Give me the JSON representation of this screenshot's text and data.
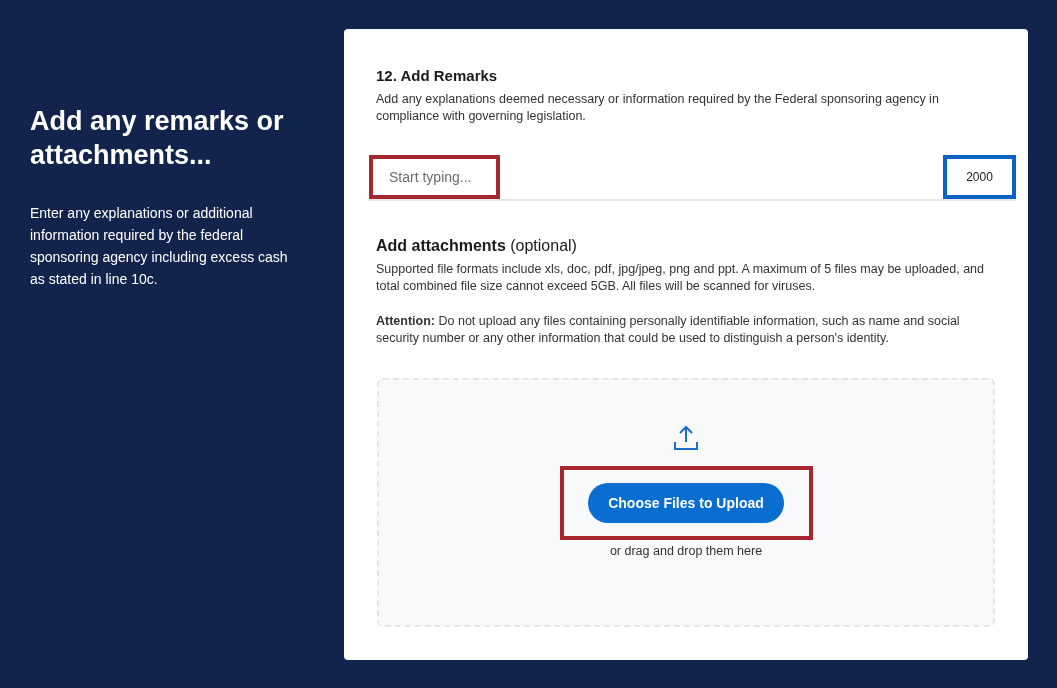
{
  "sidebar": {
    "title": "Add any remarks or attachments...",
    "description": "Enter any explanations or additional information required by the federal sponsoring agency including excess cash as stated in line 10c."
  },
  "remarks": {
    "title": "12. Add Remarks",
    "description": "Add any explanations deemed necessary or information required by the Federal sponsoring agency in compliance with governing legislation.",
    "input": {
      "placeholder": "Start typing...",
      "color": "#a8262e"
    },
    "character_count": {
      "text": "2000",
      "color": "#0b63c6"
    }
  },
  "attachments": {
    "title": "**Add attachments** (optional)",
    "description": "Supported file formats include xls, doc, pdf, jpg/jpeg, png and ppt. A maximum of 5 files may be uploaded, and total combined file size cannot exceed 5GB. All files will be scanned for viruses.",
    "attention": "**Attention:** Do not upload any files containing personally identifiable information, such as name and social security number or any other information that could be used to distinguish a person's identity.",
    "dropzone": {
      "button": {
        "label": "Choose Files to Upload",
        "color": "#a8262e"
      },
      "hint": "or drag and drop them here"
    }
  }
}
